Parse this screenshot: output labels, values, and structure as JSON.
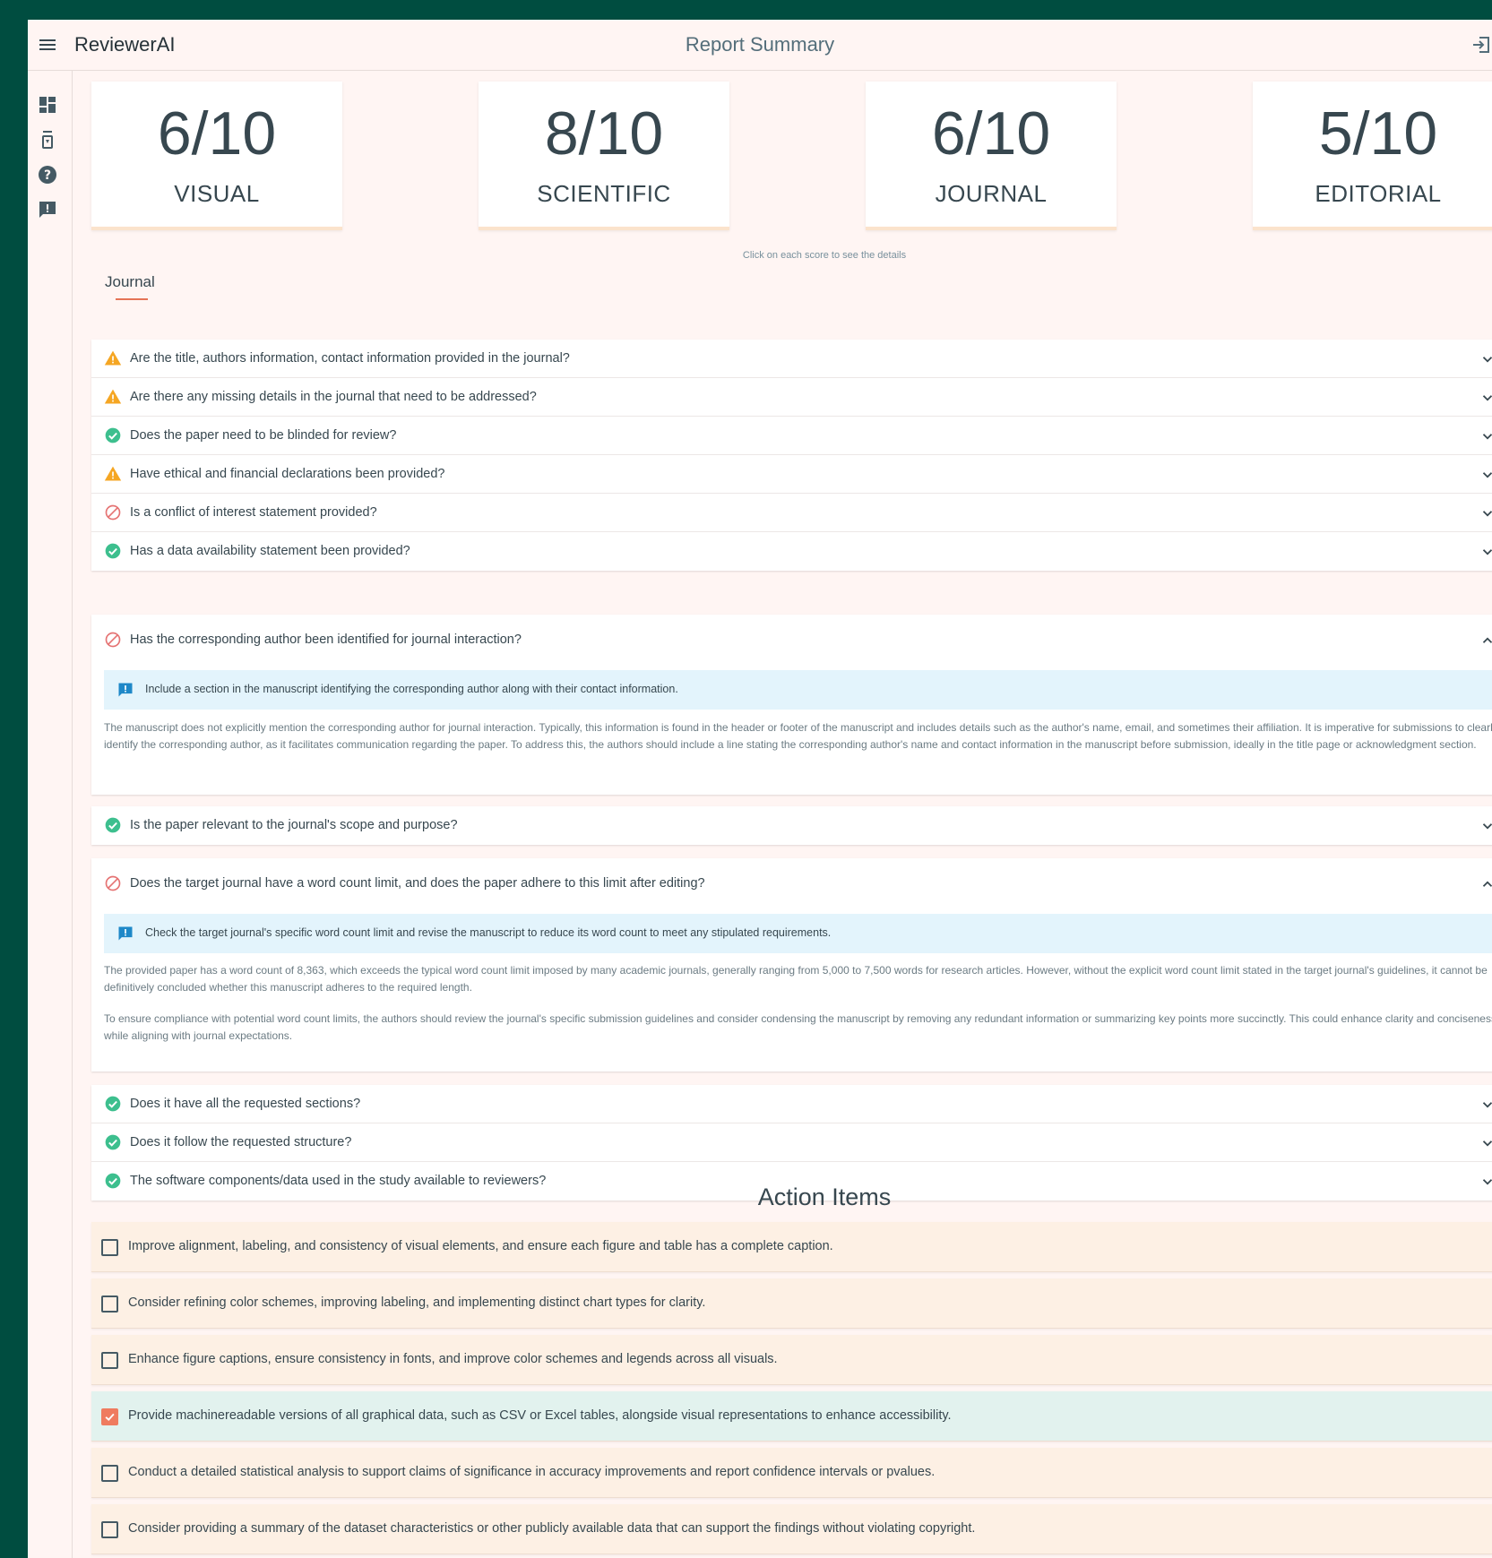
{
  "app": {
    "brand": "ReviewerAI",
    "page_title": "Report Summary"
  },
  "scores": [
    {
      "value": "6/10",
      "label": "VISUAL"
    },
    {
      "value": "8/10",
      "label": "SCIENTIFIC"
    },
    {
      "value": "6/10",
      "label": "JOURNAL"
    },
    {
      "value": "5/10",
      "label": "EDITORIAL"
    }
  ],
  "hint": "Click on each score to see the details",
  "tab": "Journal",
  "group1": [
    {
      "status": "warning",
      "text": "Are the title, authors information, contact information provided in the journal?"
    },
    {
      "status": "warning",
      "text": "Are there any missing details in the journal that need to be addressed?"
    },
    {
      "status": "success",
      "text": "Does the paper need to be blinded for review?"
    },
    {
      "status": "warning",
      "text": "Have ethical and financial declarations been provided?"
    },
    {
      "status": "error",
      "text": "Is a conflict of interest statement provided?"
    },
    {
      "status": "success",
      "text": "Has a data availability statement been provided?"
    }
  ],
  "expanded1": {
    "status": "error",
    "text": "Has the corresponding author been identified for journal interaction?",
    "suggestion": "Include a section in the manuscript identifying the corresponding author along with their contact information.",
    "detail": "The manuscript does not explicitly mention the corresponding author for journal interaction. Typically, this information is found in the header or footer of the manuscript and includes details such as the author's name, email, and sometimes their affiliation. It is imperative for submissions to clearly identify the corresponding author, as it facilitates communication regarding the paper. To address this, the authors should include a line stating the corresponding author's name and contact information in the manuscript before submission, ideally in the title page or acknowledgment section."
  },
  "single1": {
    "status": "success",
    "text": "Is the paper relevant to the journal's scope and purpose?"
  },
  "expanded2": {
    "status": "error",
    "text": "Does the target journal have a word count limit, and does the paper adhere to this limit after editing?",
    "suggestion": "Check the target journal's specific word count limit and revise the manuscript to reduce its word count to meet any stipulated requirements.",
    "detail_1": "The provided paper has a word count of 8,363, which exceeds the typical word count limit imposed by many academic journals, generally ranging from 5,000 to 7,500 words for research articles. However, without the explicit word count limit stated in the target journal's guidelines, it cannot be definitively concluded whether this manuscript adheres to the required length.",
    "detail_2": "To ensure compliance with potential word count limits, the authors should review the journal's specific submission guidelines and consider condensing the manuscript by removing any redundant information or summarizing key points more succinctly. This could enhance clarity and conciseness while aligning with journal expectations."
  },
  "group2": [
    {
      "status": "success",
      "text": "Does it have all the requested sections?"
    },
    {
      "status": "success",
      "text": "Does it follow the requested structure?"
    },
    {
      "status": "success",
      "text": "The software components/data used in the study available to reviewers?"
    }
  ],
  "action_items_title": "Action Items",
  "action_items": [
    {
      "checked": false,
      "text": "Improve alignment, labeling, and consistency of visual elements, and ensure each figure and table has a complete caption."
    },
    {
      "checked": false,
      "text": "Consider refining color schemes, improving labeling, and implementing distinct chart types for clarity."
    },
    {
      "checked": false,
      "text": "Enhance figure captions, ensure consistency in fonts, and improve color schemes and legends across all visuals."
    },
    {
      "checked": true,
      "text": "Provide machinereadable versions of all graphical data, such as CSV or Excel tables, alongside visual representations to enhance accessibility."
    },
    {
      "checked": false,
      "text": "Conduct a detailed statistical analysis to support claims of significance in accuracy improvements and report confidence intervals or pvalues."
    },
    {
      "checked": false,
      "text": "Consider providing a summary of the dataset characteristics or other publicly available data that can support the findings without violating copyright."
    }
  ],
  "icons": {
    "menu": "menu-icon",
    "logout": "logout-icon",
    "nav": [
      "dashboard-icon",
      "hourglass-icon",
      "help-icon",
      "feedback-icon"
    ],
    "status": {
      "warning": "warning-icon",
      "success": "check-circle-icon",
      "error": "block-icon"
    }
  },
  "colors": {
    "accent": "#ef7b5f",
    "warning": "#f5a623",
    "success": "#3dbf8e",
    "error": "#e57373",
    "info": "#1e88c8",
    "header_bg": "#004d40"
  }
}
